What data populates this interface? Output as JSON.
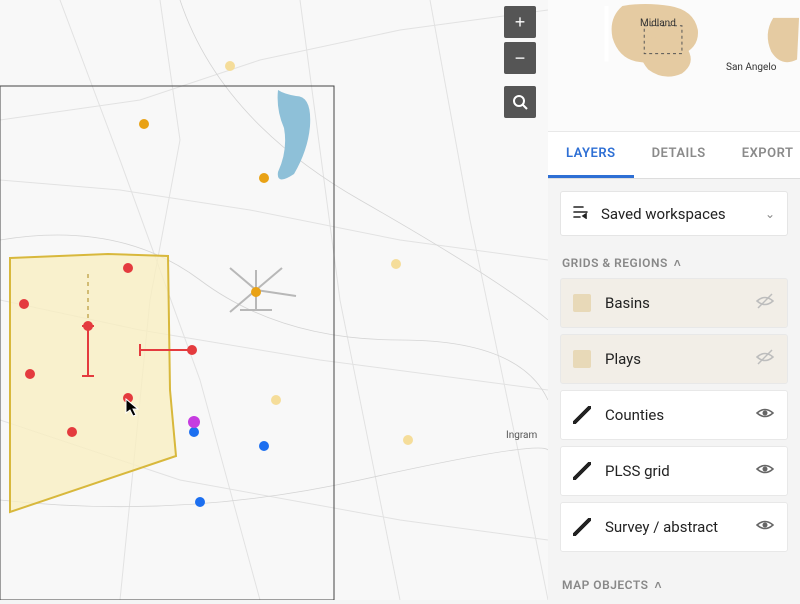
{
  "tabs": {
    "layers": "LAYERS",
    "details": "DETAILS",
    "export": "EXPORT"
  },
  "saved_workspaces_label": "Saved workspaces",
  "sections": {
    "grids_regions": "GRIDS & REGIONS",
    "map_objects": "MAP OBJECTS"
  },
  "layers": [
    {
      "label": "Basins",
      "swatch": "filled",
      "visible": false,
      "muted": true
    },
    {
      "label": "Plays",
      "swatch": "filled",
      "visible": false,
      "muted": true
    },
    {
      "label": "Counties",
      "swatch": "line",
      "visible": true,
      "muted": false
    },
    {
      "label": "PLSS grid",
      "swatch": "line",
      "visible": true,
      "muted": false
    },
    {
      "label": "Survey / abstract",
      "swatch": "line",
      "visible": true,
      "muted": false
    }
  ],
  "minimap": {
    "midland": "Midland",
    "san_angelo": "San Angelo"
  },
  "map_label_ingram": "Ingram",
  "colors": {
    "red": "#e43b3e",
    "amber": "#e9a215",
    "pale_amber": "#f5dd9a",
    "blue": "#1c6ff0",
    "magenta": "#c63ce0",
    "poly_fill": "#f9efbf",
    "poly_stroke": "#d8b83c",
    "water": "#8ec0d8"
  }
}
